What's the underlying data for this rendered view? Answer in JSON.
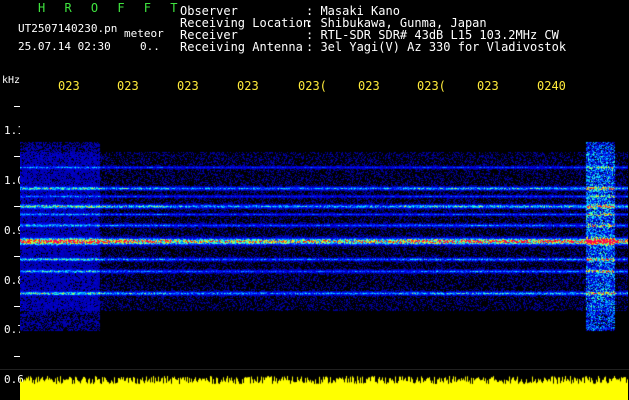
{
  "header": {
    "brand": "H R O F F T",
    "filename": "UT2507140230.pn",
    "type": "meteor",
    "datetime": "25.07.14 02:30",
    "count": "0.."
  },
  "station": [
    {
      "key": "Observer",
      "value": ": Masaki Kano"
    },
    {
      "key": "Receiving Location",
      "value": ": Shibukawa, Gunma, Japan"
    },
    {
      "key": "Receiver",
      "value": ": RTL-SDR SDR# 43dB L15 103.2MHz CW"
    },
    {
      "key": "Receiving Antenna",
      "value": ": 3el Yagi(V) Az 330 for Vladivostok"
    }
  ],
  "axis": {
    "unit": "kHz",
    "time_ticks": [
      "023",
      "023",
      "023",
      "023",
      "023(",
      "023",
      "023(",
      "023",
      "0240"
    ],
    "freq_labels": [
      "1.1",
      "1.0",
      "0.9",
      "0.8",
      "0.7",
      "0.6"
    ]
  },
  "colors": {
    "brand": "#3fe43f",
    "ticks": "#ffeb3b",
    "level": "#ffff00",
    "background": "#000000"
  }
}
